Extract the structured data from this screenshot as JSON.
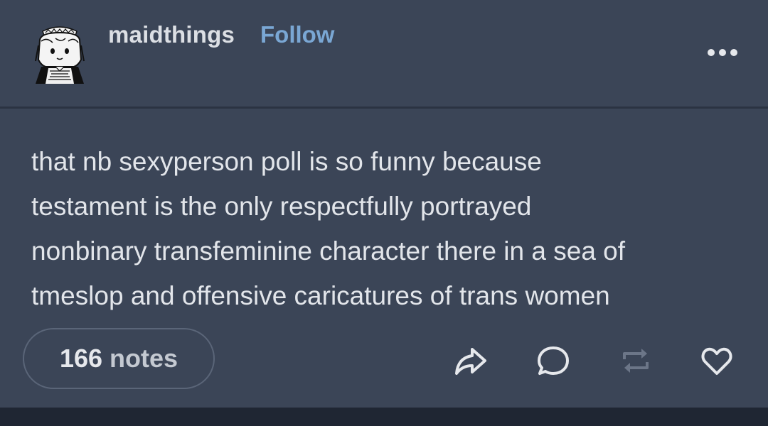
{
  "post": {
    "author": "maidthings",
    "follow_label": "Follow",
    "body_lines": [
      "that nb sexyperson poll is so funny because",
      "testament is the only respectfully portrayed",
      "nonbinary transfeminine character there in a sea of",
      "tmeslop and offensive caricatures of trans women"
    ],
    "notes_count": "166",
    "notes_label": "notes"
  },
  "icons": {
    "avatar": "maid-avatar-icon",
    "more": "more-horizontal-icon",
    "share": "share-arrow-icon",
    "reply": "speech-bubble-icon",
    "reblog": "reblog-icon",
    "like": "heart-icon"
  },
  "colors": {
    "background": "#3b4557",
    "follow": "#7aa7d4",
    "text": "#e2e5ea",
    "reblog_disabled": "#6c7688"
  }
}
